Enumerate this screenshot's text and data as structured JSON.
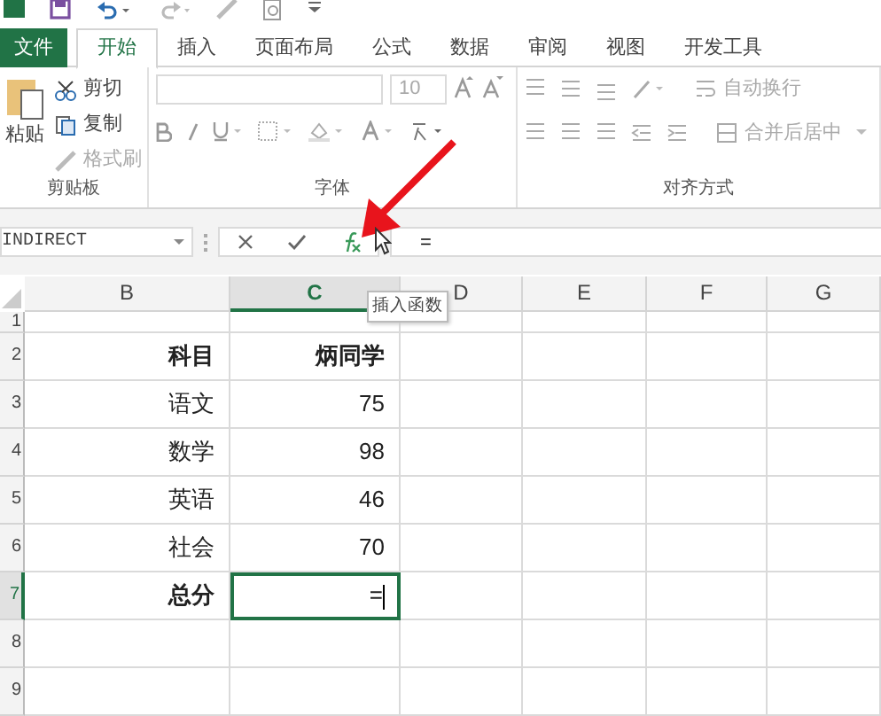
{
  "tabs": [
    {
      "label": "文件",
      "kind": "file",
      "selected": false
    },
    {
      "label": "开始",
      "kind": "tab",
      "selected": true
    },
    {
      "label": "插入",
      "kind": "tab",
      "selected": false
    },
    {
      "label": "页面布局",
      "kind": "tab",
      "selected": false
    },
    {
      "label": "公式",
      "kind": "tab",
      "selected": false
    },
    {
      "label": "数据",
      "kind": "tab",
      "selected": false
    },
    {
      "label": "审阅",
      "kind": "tab",
      "selected": false
    },
    {
      "label": "视图",
      "kind": "tab",
      "selected": false
    },
    {
      "label": "开发工具",
      "kind": "tab",
      "selected": false
    }
  ],
  "clipboard": {
    "label": "剪贴板",
    "paste": "粘贴",
    "items": [
      {
        "label": "剪切",
        "disabled": false
      },
      {
        "label": "复制",
        "disabled": false
      },
      {
        "label": "格式刷",
        "disabled": true
      }
    ]
  },
  "font": {
    "label": "字体",
    "size": "10"
  },
  "alignment": {
    "label": "对齐方式",
    "wrap": "自动换行",
    "merge": "合并后居中"
  },
  "formula_bar": {
    "name_box": "INDIRECT",
    "formula": "=",
    "tooltip": "插入函数"
  },
  "columns": [
    {
      "label": "B",
      "selected": false
    },
    {
      "label": "C",
      "selected": true
    },
    {
      "label": "D",
      "selected": false
    },
    {
      "label": "E",
      "selected": false
    },
    {
      "label": "F",
      "selected": false
    },
    {
      "label": "G",
      "selected": false
    }
  ],
  "rows": [
    {
      "number": "1",
      "selected": false,
      "cells": [
        "",
        ""
      ]
    },
    {
      "number": "2",
      "selected": false,
      "header": true,
      "cells": [
        "科目",
        "炳同学"
      ]
    },
    {
      "number": "3",
      "selected": false,
      "cells": [
        "语文",
        "75"
      ]
    },
    {
      "number": "4",
      "selected": false,
      "cells": [
        "数学",
        "98"
      ]
    },
    {
      "number": "5",
      "selected": false,
      "cells": [
        "英语",
        "46"
      ]
    },
    {
      "number": "6",
      "selected": false,
      "cells": [
        "社会",
        "70"
      ]
    },
    {
      "number": "7",
      "selected": true,
      "header": true,
      "cells": [
        "总分",
        "="
      ]
    },
    {
      "number": "8",
      "selected": false,
      "cells": [
        "",
        ""
      ]
    },
    {
      "number": "9",
      "selected": false,
      "cells": [
        "",
        ""
      ]
    }
  ]
}
